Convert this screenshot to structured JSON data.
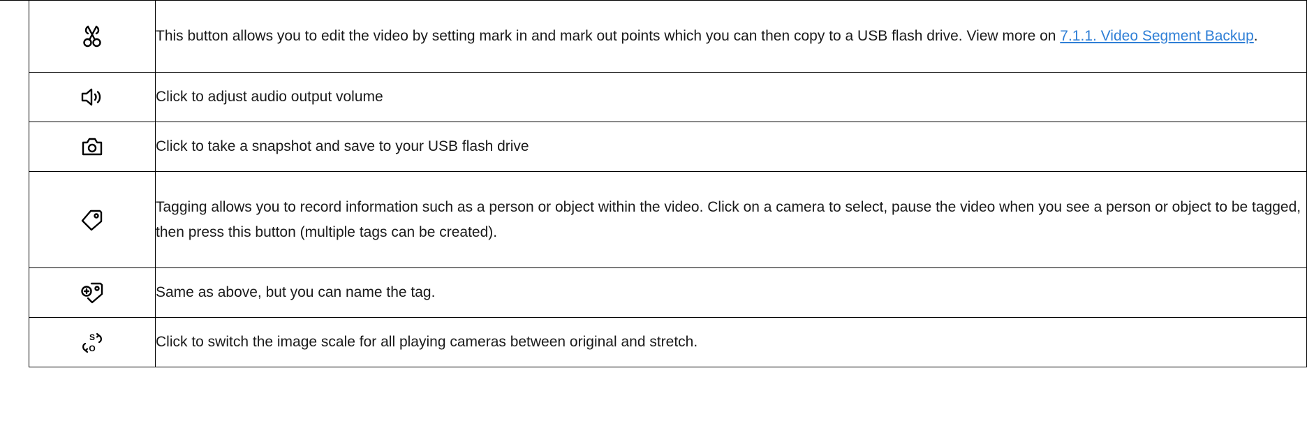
{
  "rows": [
    {
      "icon": "scissors-icon",
      "text_before": "This button allows you to edit the video by setting mark in and mark out points which you can then copy to a USB flash drive. View more on ",
      "link_text": "7.1.1. Video Segment Backup",
      "text_after": "."
    },
    {
      "icon": "speaker-volume-icon",
      "text": "Click to adjust audio output volume"
    },
    {
      "icon": "camera-snapshot-icon",
      "text": "Click to take a snapshot and save to your USB flash drive"
    },
    {
      "icon": "tag-icon",
      "text": "Tagging allows you to record information such as a person or object within the video. Click on a camera to select, pause the video when you see a person or object to be tagged, then press this button (multiple tags can be created)."
    },
    {
      "icon": "tag-add-name-icon",
      "text": "Same as above, but you can name the tag."
    },
    {
      "icon": "scale-switch-icon",
      "icon_letters": [
        "S",
        "O"
      ],
      "text": "Click to switch the image scale for all playing cameras between original and stretch."
    }
  ],
  "colors": {
    "link": "#2f7fd6",
    "border": "#000000",
    "text": "#1a1a1a"
  }
}
